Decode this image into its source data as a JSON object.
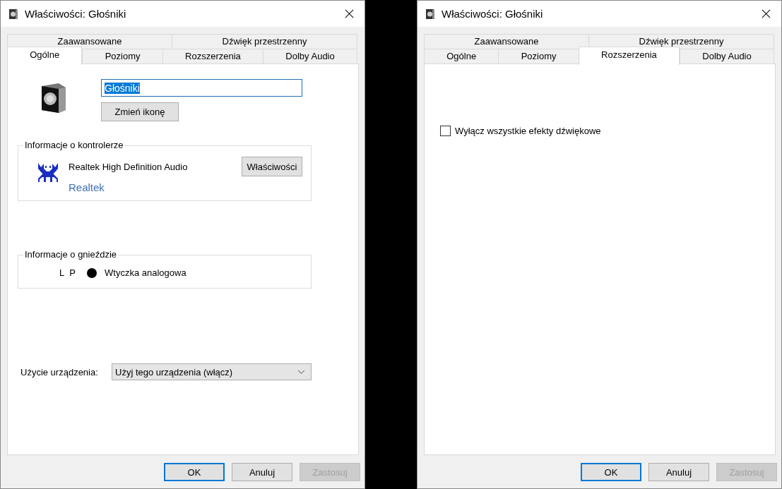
{
  "dialogs": [
    {
      "title": "Właściwości: Głośniki",
      "tab_rows": [
        [
          {
            "label": "Zaawansowane",
            "selected": false
          },
          {
            "label": "Dźwięk przestrzenny",
            "selected": false
          }
        ],
        [
          {
            "label": "Ogólne",
            "selected": true
          },
          {
            "label": "Poziomy",
            "selected": false
          },
          {
            "label": "Rozszerzenia",
            "selected": false
          },
          {
            "label": "Dolby Audio",
            "selected": false
          }
        ]
      ],
      "page": {
        "kind": "general",
        "name_field": {
          "value": "Głośniki",
          "value_selected": true
        },
        "change_icon_button": "Zmień ikonę",
        "controller_group": {
          "title": "Informacje o kontrolerze",
          "device": "Realtek High Definition Audio",
          "vendor_link": "Realtek",
          "properties_button": "Właściwości"
        },
        "jack_group": {
          "title": "Informacje o gnieździe",
          "channels": "L P",
          "jack_type": "Wtyczka analogowa"
        },
        "device_usage": {
          "label": "Użycie urządzenia:",
          "value": "Użyj tego urządzenia (włącz)"
        }
      },
      "buttons": [
        {
          "label": "OK",
          "default": true,
          "disabled": false
        },
        {
          "label": "Anuluj",
          "default": false,
          "disabled": false
        },
        {
          "label": "Zastosuj",
          "default": false,
          "disabled": true
        }
      ]
    },
    {
      "title": "Właściwości: Głośniki",
      "tab_rows": [
        [
          {
            "label": "Zaawansowane",
            "selected": false
          },
          {
            "label": "Dźwięk przestrzenny",
            "selected": false
          }
        ],
        [
          {
            "label": "Ogólne",
            "selected": false
          },
          {
            "label": "Poziomy",
            "selected": false
          },
          {
            "label": "Rozszerzenia",
            "selected": true
          },
          {
            "label": "Dolby Audio",
            "selected": false
          }
        ]
      ],
      "page": {
        "kind": "enhancements",
        "checkbox": {
          "label": "Wyłącz wszystkie efekty dźwiękowe",
          "checked": false
        }
      },
      "buttons": [
        {
          "label": "OK",
          "default": true,
          "disabled": false
        },
        {
          "label": "Anuluj",
          "default": false,
          "disabled": false
        },
        {
          "label": "Zastosuj",
          "default": false,
          "disabled": true
        }
      ]
    }
  ]
}
